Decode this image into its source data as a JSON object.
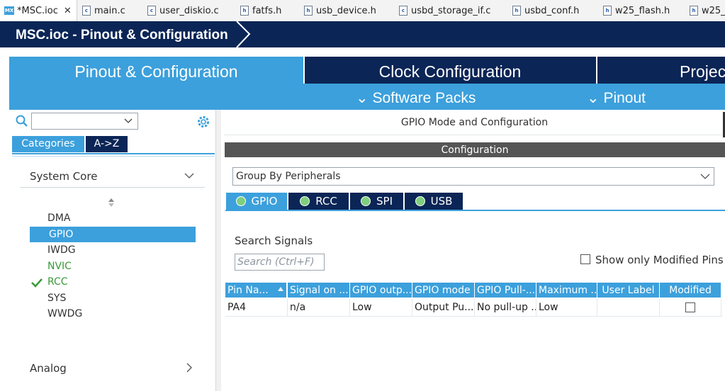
{
  "editor_tabs": [
    {
      "label": "*MSC.ioc",
      "icon": "mx-icon"
    },
    {
      "label": "main.c",
      "icon": "c-file-icon"
    },
    {
      "label": "user_diskio.c",
      "icon": "c-file-icon"
    },
    {
      "label": "fatfs.h",
      "icon": "h-file-icon"
    },
    {
      "label": "usb_device.h",
      "icon": "h-file-icon"
    },
    {
      "label": "usbd_storage_if.c",
      "icon": "c-file-icon"
    },
    {
      "label": "usbd_conf.h",
      "icon": "h-file-icon"
    },
    {
      "label": "w25_flash.h",
      "icon": "h-file-icon"
    },
    {
      "label": "w25_",
      "icon": "h-file-icon"
    }
  ],
  "breadcrumb": "MSC.ioc - Pinout & Configuration",
  "main_tabs": {
    "pinout": "Pinout & Configuration",
    "clock": "Clock Configuration",
    "project": "Projec"
  },
  "sub_menu": {
    "software_packs": "Software Packs",
    "pinout": "Pinout"
  },
  "left": {
    "tab_categories": "Categories",
    "tab_az": "A->Z",
    "system_core": "System Core",
    "items": [
      {
        "label": "DMA",
        "color": "#333333"
      },
      {
        "label": "GPIO",
        "color": "#ffffff"
      },
      {
        "label": "IWDG",
        "color": "#333333"
      },
      {
        "label": "NVIC",
        "color": "#3a9a3a"
      },
      {
        "label": "RCC",
        "color": "#3a9a3a"
      },
      {
        "label": "SYS",
        "color": "#333333"
      },
      {
        "label": "WWDG",
        "color": "#333333"
      }
    ],
    "analog": "Analog"
  },
  "right": {
    "header": "GPIO Mode and Configuration",
    "config_bar": "Configuration",
    "group_by": "Group By Peripherals",
    "peripheral_tabs": [
      "GPIO",
      "RCC",
      "SPI",
      "USB"
    ],
    "search_label": "Search Signals",
    "search_placeholder": "Search (Ctrl+F)",
    "show_modified": "Show only Modified Pins",
    "columns": [
      "Pin Na...",
      "Signal on ...",
      "GPIO outp...",
      "GPIO mode",
      "GPIO Pull-...",
      "Maximum ...",
      "User Label",
      "Modified"
    ],
    "rows": [
      [
        "PA4",
        "n/a",
        "Low",
        "Output Pu...",
        "No pull-up ...",
        "Low",
        "",
        ""
      ]
    ]
  },
  "colors": {
    "navy": "#0b2556",
    "accent": "#3ca0dc",
    "enabled_green": "#3a9a3a"
  }
}
